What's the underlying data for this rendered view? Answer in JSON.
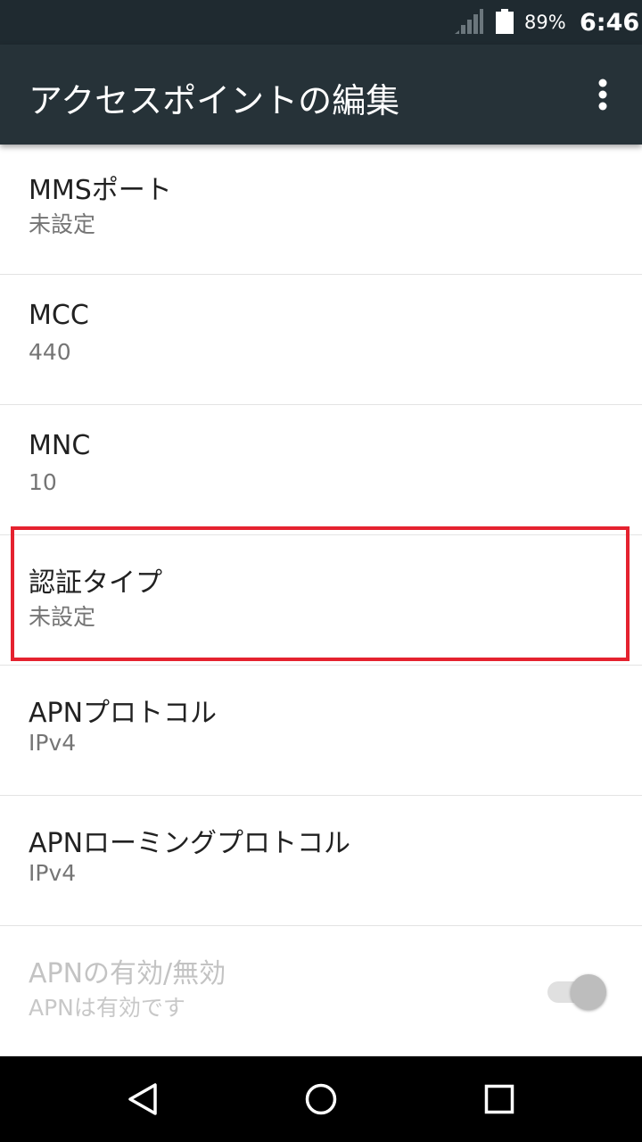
{
  "status_bar": {
    "battery_percent": "89%",
    "time": "6:46",
    "icons": [
      "signal-icon",
      "battery-icon"
    ]
  },
  "app_bar": {
    "title": "アクセスポイントの編集",
    "menu_icon": "more-vert-icon"
  },
  "settings": [
    {
      "label": "MMSポート",
      "value": "未設定"
    },
    {
      "label": "MCC",
      "value": "440"
    },
    {
      "label": "MNC",
      "value": "10"
    },
    {
      "label": "認証タイプ",
      "value": "未設定"
    },
    {
      "label": "APNプロトコル",
      "value": "IPv4"
    },
    {
      "label": "APNローミングプロトコル",
      "value": "IPv4"
    },
    {
      "label": "APNの有効/無効",
      "value": "APNは有効です",
      "enabled": false,
      "toggle_on": true
    }
  ],
  "highlighted_item": 3,
  "colors": {
    "status_bar": "#1f2a30",
    "app_bar": "#263238",
    "highlight": "#e5222f",
    "nav_bar": "#000000"
  },
  "nav_bar": {
    "icons": [
      "back-icon",
      "home-icon",
      "recents-icon"
    ]
  }
}
